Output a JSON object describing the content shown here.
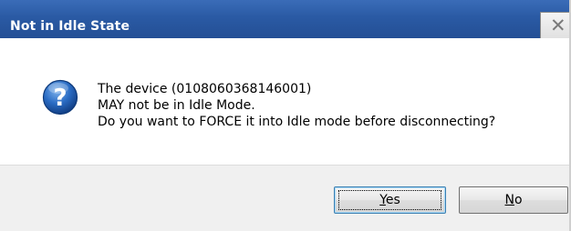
{
  "window": {
    "title": "Not in Idle State",
    "close_glyph": "✕"
  },
  "icon": {
    "name": "question-icon",
    "glyph": "?"
  },
  "message": {
    "line1": "The device (0108060368146001)",
    "line2": "MAY not be in Idle Mode.",
    "line3": "Do you want to FORCE it into Idle mode before disconnecting?"
  },
  "buttons": {
    "yes_mnemonic": "Y",
    "yes_rest": "es",
    "no_mnemonic": "N",
    "no_rest": "o"
  },
  "colors": {
    "titlebar": "#2a5aa4",
    "icon_blue": "#1f5fb0",
    "button_bar": "#f0f0f0"
  }
}
